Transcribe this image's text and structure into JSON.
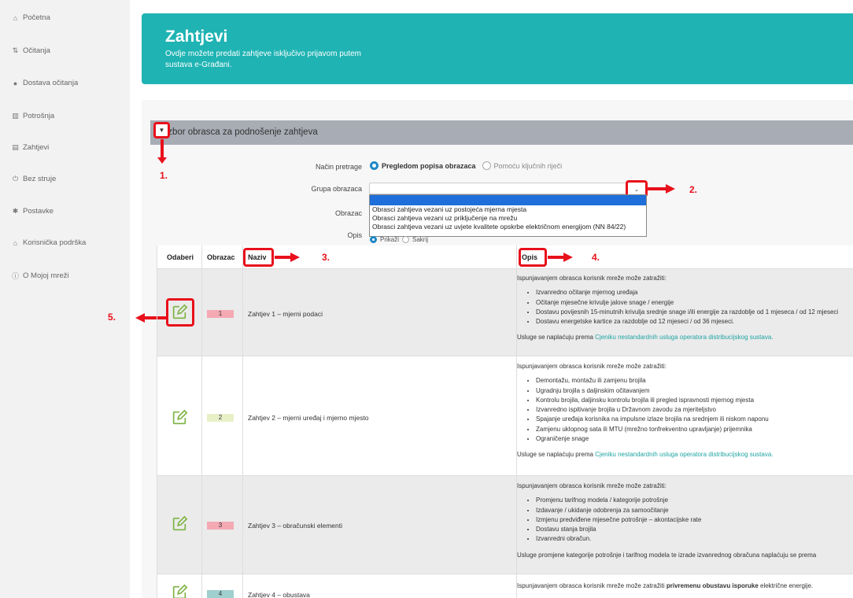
{
  "sidebar": {
    "items": [
      {
        "icon": "home-icon",
        "glyph": "⌂",
        "label": "Početna"
      },
      {
        "icon": "meter-icon",
        "glyph": "⇅",
        "label": "Očitanja"
      },
      {
        "icon": "delivery-icon",
        "glyph": "●",
        "label": "Dostava očitanja"
      },
      {
        "icon": "chart-icon",
        "glyph": "▥",
        "label": "Potrošnja"
      },
      {
        "icon": "document-icon",
        "glyph": "▤",
        "label": "Zahtjevi"
      },
      {
        "icon": "power-icon",
        "glyph": "⏻",
        "label": "Bez struje"
      },
      {
        "icon": "gear-icon",
        "glyph": "✱",
        "label": "Postavke"
      },
      {
        "icon": "support-icon",
        "glyph": "⌂",
        "label": "Korisnička podrška"
      },
      {
        "icon": "info-icon",
        "glyph": "ⓘ",
        "label": "O Mojoj mreži"
      }
    ]
  },
  "banner": {
    "title": "Zahtjevi",
    "subtitle": "Ovdje možete predati zahtjeve isključivo prijavom putem sustava e-Građani."
  },
  "section": {
    "title": "Izbor obrasca za podnošenje zahtjeva"
  },
  "annotations": {
    "a1": "1.",
    "a2": "2.",
    "a3": "3.",
    "a4": "4.",
    "a5": "5."
  },
  "form": {
    "nacin_label": "Način pretrage",
    "nacin_option1": "Pregledom popisa obrazaca",
    "nacin_option2": "Pomoću ključnih riječi",
    "grupa_label": "Grupa obrazaca",
    "obrazac_label": "Obrazac",
    "opis_label": "Opis",
    "opis_option1": "Prikaži",
    "opis_option2": "Sakrij",
    "dropdown_options": [
      "Obrasci zahtjeva vezani uz postojeća mjerna mjesta",
      "Obrasci zahtjeva vezani uz priključenje na mrežu",
      "Obrasci zahtjeva vezani uz uvjete kvalitete opskrbe električnom energijom (NN 84/22)"
    ]
  },
  "table": {
    "headers": {
      "odaberi": "Odaberi",
      "obrazac": "Obrazac",
      "naziv": "Naziv",
      "opis": "Opis"
    },
    "rows": [
      {
        "num": "1",
        "num_color": "#f4a9b3",
        "naziv": "Zahtjev 1 – mjerni podaci",
        "intro": "Ispunjavanjem obrasca korisnik mreže može zatražiti:",
        "items": [
          "Izvanredno očitanje mjernog uređaja",
          "Očitanje mjesečne krivulje jalove snage / energije",
          "Dostavu povijesnih 15-minutnih krivulja srednje snage i/ili energije za razdoblje od 1 mjeseca / od 12 mjeseci",
          "Dostavu energetske kartice za razdoblje od 12 mjeseci / od 36 mjeseci."
        ],
        "footer_text": "Usluge se naplaćuju prema ",
        "footer_link": "Cjeniku nestandardnih usluga operatora distribucijskog sustava."
      },
      {
        "num": "2",
        "num_color": "#e8f0c8",
        "naziv": "Zahtjev 2 – mjerni uređaj i mjerno mjesto",
        "intro": "Ispunjavanjem obrasca korisnik mreže može zatražiti:",
        "items": [
          "Demontažu, montažu ili zamjenu brojila",
          "Ugradnju brojila s daljinskim očitavanjem",
          "Kontrolu brojila, daljinsku kontrolu brojila ili pregled ispravnosti mjernog mjesta",
          "Izvanredno ispitivanje brojila u Državnom zavodu za mjeriteljstvo",
          "Spajanje uređaja korisnika na impulsne izlaze brojila na srednjem ili niskom naponu",
          "Zamjenu uklopnog sata ili MTU (mrežno tonfrekventno upravljanje) prijemnika",
          "Ograničenje snage"
        ],
        "footer_text": "Usluge se naplaćuju prema ",
        "footer_link": "Cjeniku nestandardnih usluga operatora distribucijskog sustava."
      },
      {
        "num": "3",
        "num_color": "#f4a9b3",
        "naziv": "Zahtjev 3 – obračunski elementi",
        "intro": "Ispunjavanjem obrasca korisnik mreže može zatražiti:",
        "items": [
          "Promjenu tarifnog modela / kategorije potrošnje",
          "Izdavanje / ukidanje odobrenja za samoočitanje",
          "Izmjenu predviđene mjesečne potrošnje – akontacijske rate",
          "Dostavu stanja brojila",
          "Izvanredni obračun."
        ],
        "footer_text": "Usluge promjene kategorije potrošnje i tarifnog modela te izrade izvanrednog obračuna naplaćuju se prema",
        "footer_link": ""
      },
      {
        "num": "4",
        "num_color": "#9fcfcf",
        "naziv": "Zahtjev 4 – obustava",
        "intro_pre": "Ispunjavanjem obrasca korisnik mreže može zatražiti ",
        "intro_bold": "privremenu obustavu isporuke",
        "intro_post": " električne energije."
      }
    ]
  }
}
